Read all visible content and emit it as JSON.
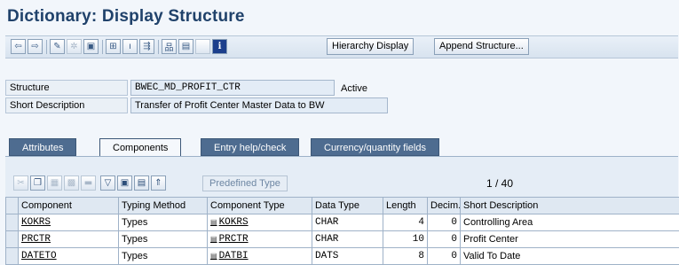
{
  "window": {
    "title": "Dictionary: Display Structure"
  },
  "toolbar": {
    "hierarchy_label": "Hierarchy Display",
    "append_label": "Append Structure..."
  },
  "header": {
    "structure_label": "Structure",
    "structure_value": "BWEC_MD_PROFIT_CTR",
    "status": "Active",
    "desc_label": "Short Description",
    "desc_value": "Transfer of Profit Center Master Data to BW"
  },
  "tabs": [
    {
      "label": "Attributes"
    },
    {
      "label": "Components"
    },
    {
      "label": "Entry help/check"
    },
    {
      "label": "Currency/quantity fields"
    }
  ],
  "table_toolbar": {
    "predefined_label": "Predefined Type",
    "pager": "1  /  40"
  },
  "table": {
    "headers": [
      "Component",
      "Typing Method",
      "Component Type",
      "Data Type",
      "Length",
      "Decim...",
      "Short Description"
    ],
    "rows": [
      {
        "component": "KOKRS",
        "typing": "Types",
        "comp_type": "KOKRS",
        "data_type": "CHAR",
        "length": "4",
        "decimals": "0",
        "desc": "Controlling Area"
      },
      {
        "component": "PRCTR",
        "typing": "Types",
        "comp_type": "PRCTR",
        "data_type": "CHAR",
        "length": "10",
        "decimals": "0",
        "desc": "Profit Center"
      },
      {
        "component": "DATETO",
        "typing": "Types",
        "comp_type": "DATBI",
        "data_type": "DATS",
        "length": "8",
        "decimals": "0",
        "desc": "Valid To Date"
      }
    ]
  }
}
